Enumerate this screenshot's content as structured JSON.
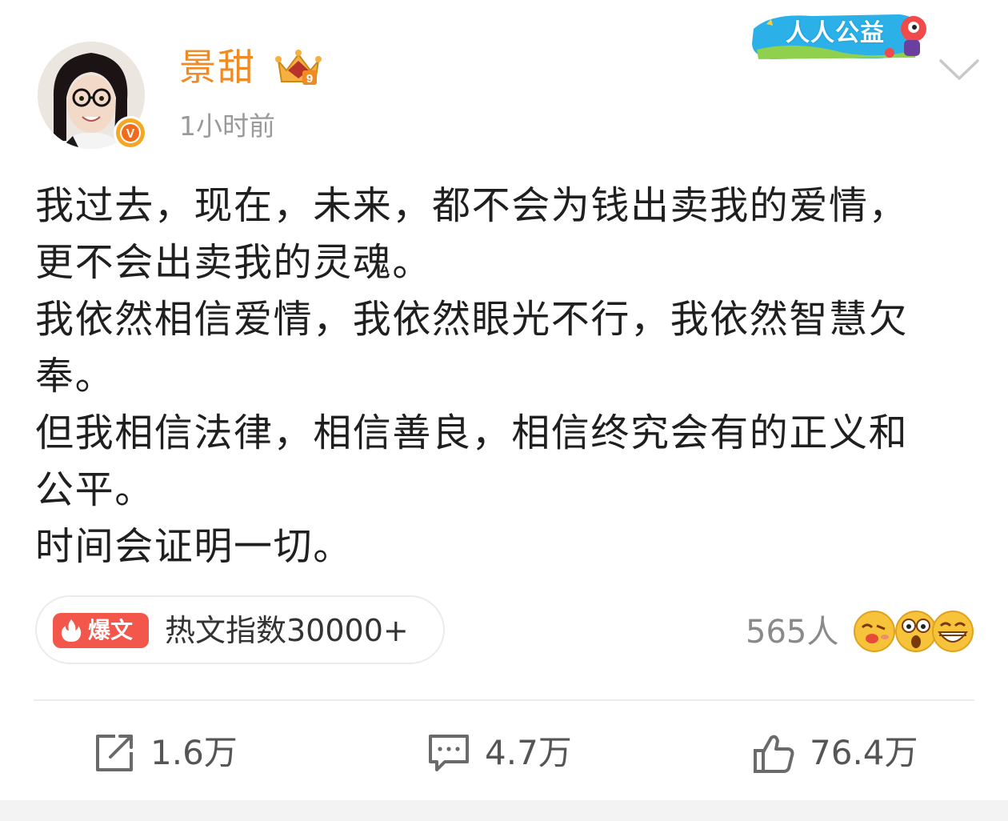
{
  "header": {
    "username": "景甜",
    "level_badge": "9",
    "timestamp": "1小时前",
    "charity_badge": "人人公益",
    "verified_mark": "V"
  },
  "post": {
    "lines": [
      "我过去，现在，未来，都不会为钱出卖我的爱情，",
      "更不会出卖我的灵魂。",
      "我依然相信爱情，我依然眼光不行，我依然智慧欠",
      "奉。",
      "但我相信法律，相信善良，相信终究会有的正义和",
      "公平。",
      "时间会证明一切。"
    ]
  },
  "hot": {
    "tag_label": "爆文",
    "index_text": "热文指数30000+"
  },
  "reactions": {
    "count": "565人",
    "emojis": [
      "kiss-emoji-icon",
      "surprised-emoji-icon",
      "grin-emoji-icon"
    ]
  },
  "actions": {
    "repost": "1.6万",
    "comment": "4.7万",
    "like": "76.4万"
  },
  "colors": {
    "username": "#f08a24",
    "hot_tag": "#f3564a",
    "text": "#1f1f1f",
    "muted": "#9a9a9a",
    "verified": "#f5a623"
  }
}
